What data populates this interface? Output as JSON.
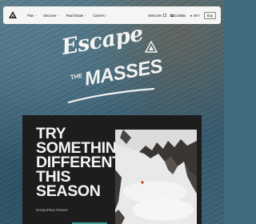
{
  "nav": {
    "items": [
      {
        "label": "Plan",
        "has_dropdown": true
      },
      {
        "label": "Discover",
        "has_dropdown": true
      },
      {
        "label": "Real Estate",
        "has_dropdown": true
      },
      {
        "label": "Careers",
        "has_dropdown": true
      }
    ],
    "welcome_label": "Welcome",
    "wallet_label": "£14BBs",
    "points_label": "4KY",
    "buy_label": "Buy"
  },
  "hero": {
    "script_text": "Escape",
    "the_text": "THE",
    "masses_text": "MASSES"
  },
  "card": {
    "headline": "TRY\nSOMETHING\nDIFFERENT\nTHIS SEASON",
    "subline": "NoSpoPass Passes"
  },
  "colors": {
    "nav_bg": "#f5f5f3",
    "card_bg": "#1d1d1d",
    "accent": "#3c9a92",
    "text_light": "#f4f4f2"
  }
}
